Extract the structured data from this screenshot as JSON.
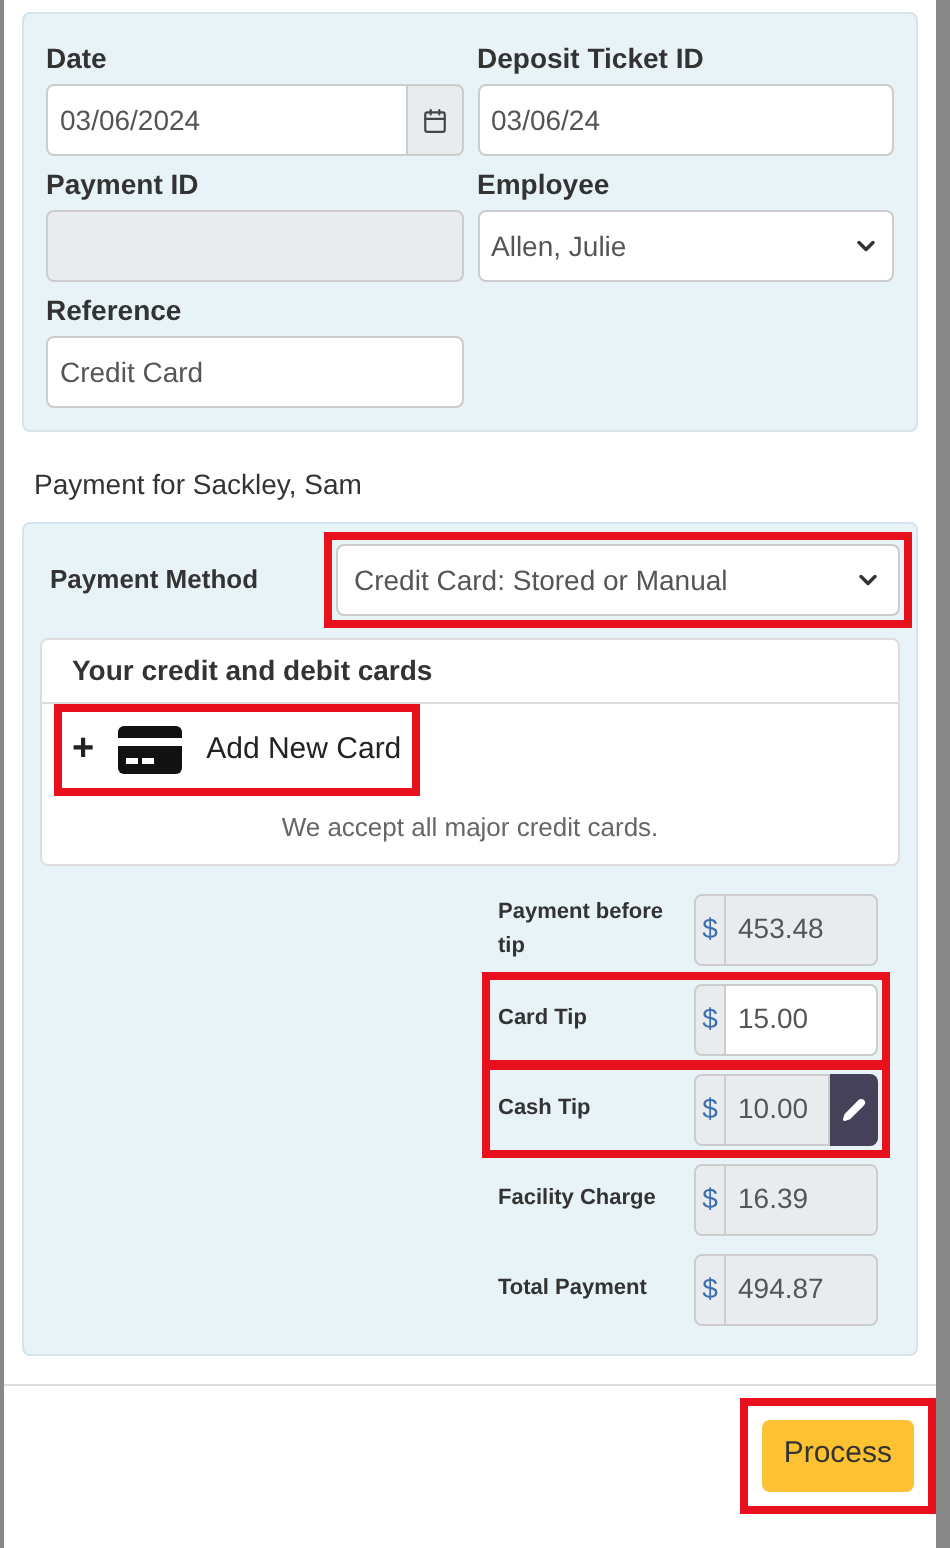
{
  "details": {
    "date": {
      "label": "Date",
      "value": "03/06/2024"
    },
    "deposit_ticket_id": {
      "label": "Deposit Ticket ID",
      "value": "03/06/24"
    },
    "payment_id": {
      "label": "Payment ID",
      "disabled": true
    },
    "employee": {
      "label": "Employee",
      "value": "Allen, Julie"
    },
    "reference": {
      "label": "Reference",
      "value": "Credit Card"
    }
  },
  "payment_for": "Payment for Sackley, Sam",
  "payment_method": {
    "label": "Payment Method",
    "value": "Credit Card: Stored or Manual",
    "highlighted": true
  },
  "cards": {
    "title": "Your credit and debit cards",
    "add_card": {
      "plus": "+",
      "label": "Add New Card",
      "highlighted": true
    },
    "note": "We accept all major credit cards."
  },
  "amounts": [
    {
      "label": "Payment before tip",
      "currency": "$",
      "value": "453.48",
      "kind": "readonly",
      "highlighted": false
    },
    {
      "label": "Card Tip",
      "currency": "$",
      "value": "15.00",
      "kind": "input",
      "highlighted": true
    },
    {
      "label": "Cash Tip",
      "currency": "$",
      "value": "10.00",
      "kind": "editable",
      "highlighted": true
    },
    {
      "label": "Facility Charge",
      "currency": "$",
      "value": "16.39",
      "kind": "readonly",
      "highlighted": false
    },
    {
      "label": "Total Payment",
      "currency": "$",
      "value": "494.87",
      "kind": "readonly",
      "highlighted": false
    }
  ],
  "process_button": {
    "label": "Process",
    "highlighted": true
  }
}
